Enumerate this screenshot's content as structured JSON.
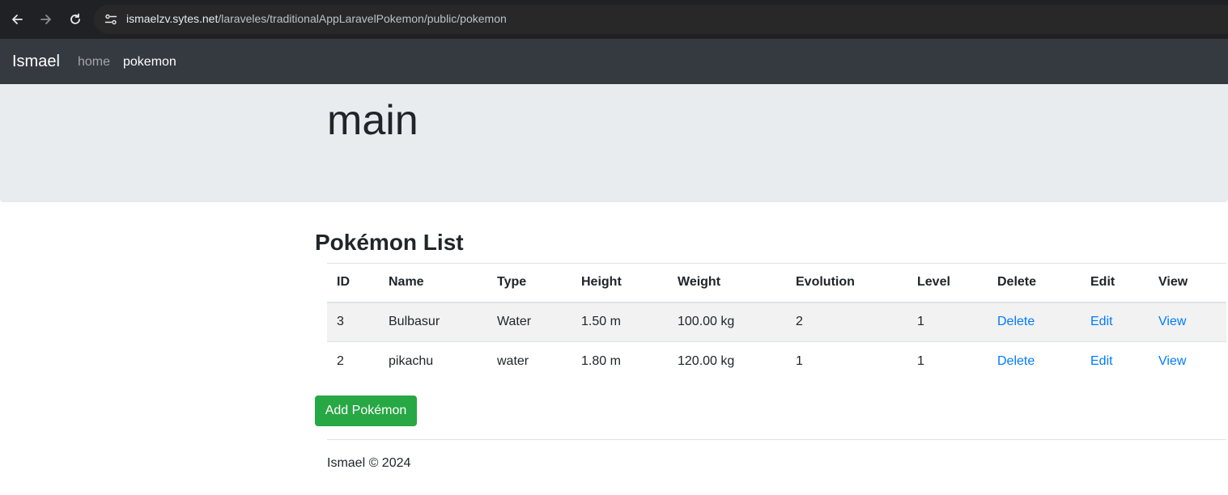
{
  "browser": {
    "url_host": "ismaelzv.sytes.net",
    "url_path": "/laraveles/traditionalAppLaravelPokemon/public/pokemon"
  },
  "navbar": {
    "brand": "Ismael",
    "links": [
      {
        "label": "home",
        "active": false
      },
      {
        "label": "pokemon",
        "active": true
      }
    ]
  },
  "jumbotron": {
    "title": "main"
  },
  "list": {
    "title": "Pokémon List",
    "columns": [
      "ID",
      "Name",
      "Type",
      "Height",
      "Weight",
      "Evolution",
      "Level",
      "Delete",
      "Edit",
      "View"
    ],
    "rows": [
      {
        "id": "3",
        "name": "Bulbasur",
        "type": "Water",
        "height": "1.50 m",
        "weight": "100.00 kg",
        "evolution": "2",
        "level": "1",
        "delete": "Delete",
        "edit": "Edit",
        "view": "View"
      },
      {
        "id": "2",
        "name": "pikachu",
        "type": "water",
        "height": "1.80 m",
        "weight": "120.00 kg",
        "evolution": "1",
        "level": "1",
        "delete": "Delete",
        "edit": "Edit",
        "view": "View"
      }
    ],
    "add_button": "Add Pokémon"
  },
  "footer": {
    "text": "Ismael © 2024"
  },
  "colors": {
    "navbar_bg": "#343a40",
    "jumbotron_bg": "#e9ecef",
    "link": "#007bff",
    "success": "#28a745"
  }
}
